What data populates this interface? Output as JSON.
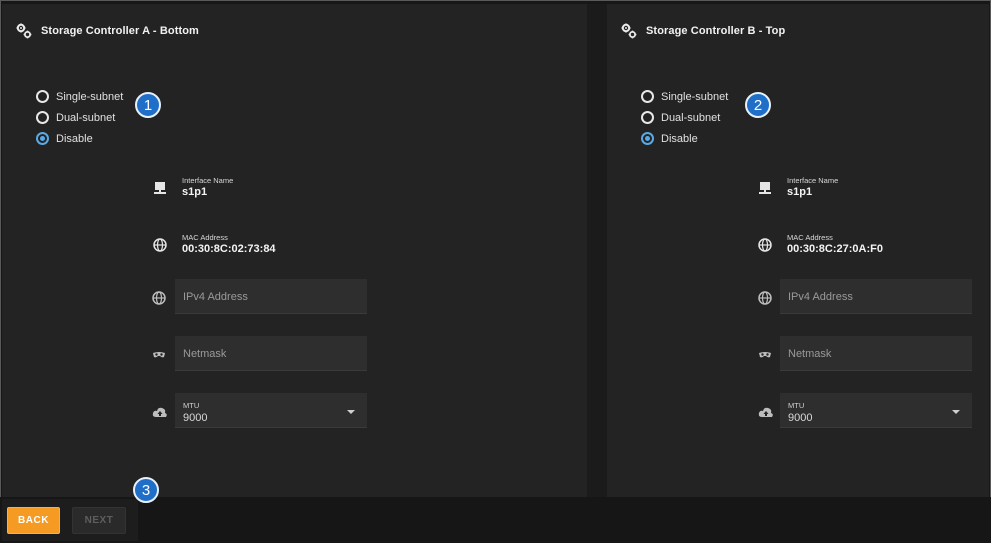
{
  "controllers": [
    {
      "title": "Storage Controller A - Bottom",
      "radio_options": [
        {
          "label": "Single-subnet",
          "checked": false
        },
        {
          "label": "Dual-subnet",
          "checked": false
        },
        {
          "label": "Disable",
          "checked": true
        }
      ],
      "badge": "1",
      "interface_name_label": "Interface Name",
      "interface_name_value": "s1p1",
      "mac_label": "MAC Address",
      "mac_value": "00:30:8C:02:73:84",
      "ipv4_placeholder": "IPv4 Address",
      "netmask_placeholder": "Netmask",
      "mtu_label": "MTU",
      "mtu_value": "9000"
    },
    {
      "title": "Storage Controller B - Top",
      "radio_options": [
        {
          "label": "Single-subnet",
          "checked": false
        },
        {
          "label": "Dual-subnet",
          "checked": false
        },
        {
          "label": "Disable",
          "checked": true
        }
      ],
      "badge": "2",
      "interface_name_label": "Interface Name",
      "interface_name_value": "s1p1",
      "mac_label": "MAC Address",
      "mac_value": "00:30:8C:27:0A:F0",
      "ipv4_placeholder": "IPv4 Address",
      "netmask_placeholder": "Netmask",
      "mtu_label": "MTU",
      "mtu_value": "9000"
    }
  ],
  "footer": {
    "badge": "3",
    "back_label": "BACK",
    "next_label": "NEXT"
  },
  "colors": {
    "accent_blue": "#5aa9e6",
    "badge_blue": "#1f6ec7",
    "back_orange": "#f59a23"
  },
  "icons": {
    "title": "gears-icon",
    "interface": "network-port-icon",
    "mac": "globe-icon",
    "ipv4": "globe-icon",
    "netmask": "mask-icon",
    "mtu": "cloud-upload-icon"
  }
}
